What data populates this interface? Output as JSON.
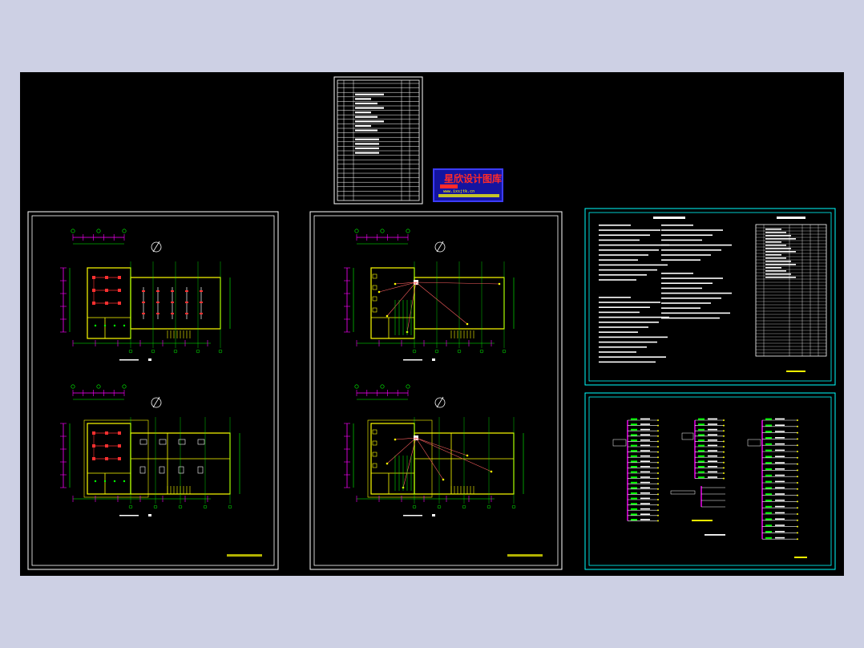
{
  "watermark": {
    "title": "星欣设计图库",
    "url": "www.ixsjtk.cn"
  },
  "colors": {
    "background": "#cdd0e4",
    "canvas": "#000000",
    "sheet_frame": "#ffffff",
    "cyan_frame": "#00ffff",
    "axis": "#00ff00",
    "wall": "#ffff00",
    "fixture": "#ff3030",
    "magenta": "#ff00ff",
    "wire": "#ff6060",
    "watermark_bg": "#1414a0",
    "watermark_border": "#3c3cff"
  }
}
